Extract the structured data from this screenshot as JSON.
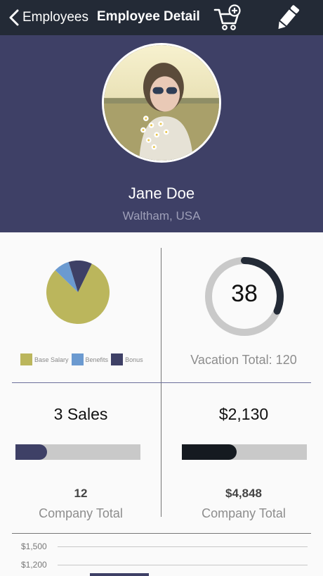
{
  "nav": {
    "back_label": "Employees",
    "title": "Employee Detail",
    "icons": [
      "chevron-left-icon",
      "cart-add-icon",
      "pencil-icon"
    ]
  },
  "profile": {
    "name": "Jane Doe",
    "location": "Waltham, USA"
  },
  "compensation": {
    "chart_data": {
      "type": "pie",
      "labels": [
        "Base Salary",
        "Benefits",
        "Bonus"
      ],
      "values": [
        80,
        8,
        12
      ],
      "colors": [
        "#bbb65c",
        "#6b9ad0",
        "#3e4066"
      ]
    }
  },
  "vacation": {
    "value": "38",
    "total_label": "Vacation Total: 120",
    "fraction": 0.3167,
    "colors": {
      "fill": "#232a36",
      "track": "#c9c9c9"
    }
  },
  "sales": {
    "count_label": "3 Sales",
    "fraction": 0.25,
    "company_total": "12",
    "company_caption": "Company Total",
    "color": "#3e4066"
  },
  "revenue": {
    "amount_label": "$2,130",
    "fraction": 0.44,
    "company_total": "$4,848",
    "company_caption": "Company Total",
    "color": "#151a20"
  },
  "bottom_chart": {
    "y_ticks": [
      "$1,500",
      "$1,200"
    ]
  },
  "colors": {
    "header_bg": "#3e4066",
    "nav_bg": "#232a36",
    "accent_gold": "#bbb65c",
    "accent_blue": "#6b9ad0"
  }
}
